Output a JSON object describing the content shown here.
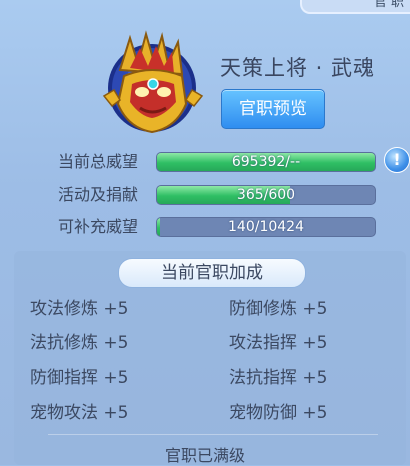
{
  "header": {
    "partial_title": "官 职"
  },
  "rank": {
    "title": "天策上将 · 武魂",
    "preview_button": "官职预览"
  },
  "stats": [
    {
      "label": "当前总威望",
      "text": "695392/--",
      "fill": 1.0
    },
    {
      "label": "活动及捐献",
      "text": "365/600",
      "fill": 0.608
    },
    {
      "label": "可补充威望",
      "text": "140/10424",
      "fill": 0.013
    }
  ],
  "info_button": "!",
  "bonus": {
    "header": "当前官职加成",
    "items": [
      {
        "name": "攻法修炼",
        "value": "+5"
      },
      {
        "name": "防御修炼",
        "value": "+5"
      },
      {
        "name": "法抗修炼",
        "value": "+5"
      },
      {
        "name": "攻法指挥",
        "value": "+5"
      },
      {
        "name": "防御指挥",
        "value": "+5"
      },
      {
        "name": "法抗指挥",
        "value": "+5"
      },
      {
        "name": "宠物攻法",
        "value": "+5"
      },
      {
        "name": "宠物防御",
        "value": "+5"
      }
    ],
    "status": "官职已满级"
  },
  "colors": {
    "bar_fill": "#2fbf64",
    "bar_bg": "#6e86b4",
    "button": "#2f8df0"
  },
  "icons": {
    "avatar": "helmet-emblem-icon",
    "info": "exclamation-icon"
  }
}
